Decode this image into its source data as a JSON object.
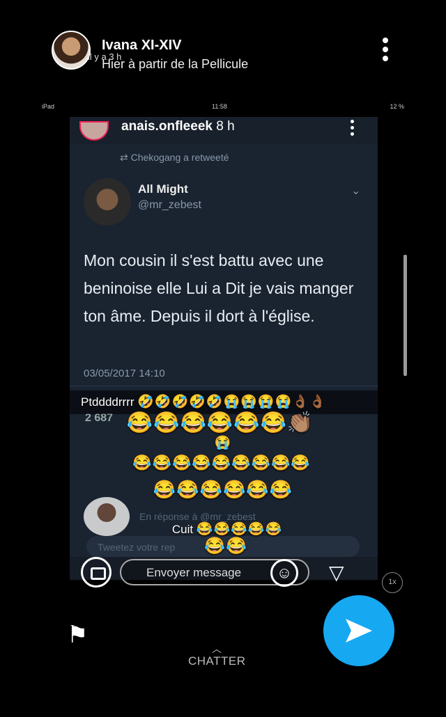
{
  "story": {
    "display_name": "Ivana XI-XIV",
    "time_ago": "il y a 3 h",
    "subtitle": "Hier à partir de la Pellicule"
  },
  "ipad_status": {
    "left": "iPad",
    "time": "11:58",
    "battery": "12 %"
  },
  "inner": {
    "username": "anais.onfleeek",
    "username_age": "8 h",
    "retweet_line": "Chekogang a retweeté",
    "tweet": {
      "name": "All Might",
      "handle": "@mr_zebest",
      "text": "Mon cousin il s'est battu avec une beninoise elle Lui a Dit je vais manger ton âme. Depuis il dort à l'église.",
      "date": "03/05/2017 14:10",
      "retweets": "2 687",
      "reply_hint": "En réponse à @mr_zebest",
      "reply_placeholder": "Tweetez votre rep"
    }
  },
  "captions": {
    "line1_text": "Ptddddrrrr",
    "line1_emoji": "🤣🤣🤣🤣🤣😭😭😭😭👌🏾👌🏾",
    "line2_emoji": "😂😂😂😂😂😂👏🏽",
    "line3_emoji": "😭",
    "line4_emoji": "😂😂😂😂😂😂😂😂😂",
    "line5_emoji": "😂😂😂😂😂😂",
    "line6_text": "Cuit",
    "line6_emoji": "😂😂😂😂😂",
    "line7_emoji": "😂😂"
  },
  "footer": {
    "message_placeholder": "Envoyer message",
    "speed": "1x",
    "chat_label": "CHATTER"
  }
}
